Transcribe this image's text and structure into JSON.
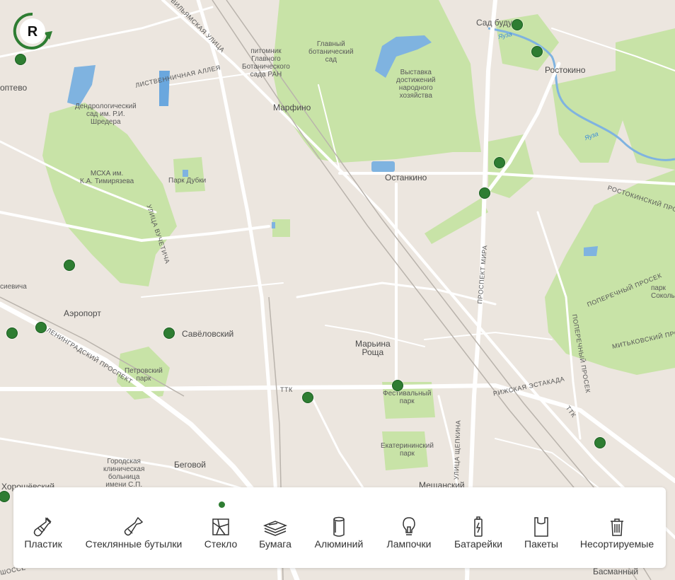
{
  "map": {
    "place_labels": {
      "sad_budushchego": "Сад будущ",
      "rostokino": "Ростокино",
      "glavny_bot_sad": "Главный\nботанический\nсад",
      "pitomnik": "питомник\nГлавного\nБотанического\nсада РАН",
      "vystavka": "Выставка\nдостижений\nнародного\nхозяйства",
      "marfino": "Марфино",
      "ostankino": "Останкино",
      "dendrolog": "Дендрологический\nсад им. Р.И.\nШредера",
      "mskha": "МСХА им.\nК.А. Тимирязева",
      "park_dubki": "Парк Дубки",
      "aeroport": "Аэропорт",
      "savelovsky": "Савёловский",
      "maryina_roshcha": "Марьина\nРоща",
      "festivalny_park": "Фестивальный\nпарк",
      "petrovsky_park": "Петровский\nпарк",
      "ekaterininsky_park": "Екатерининский\nпарк",
      "gorodskaya_bolnitsa": "Городская\nклиническая\nбольница\nимени С.П.",
      "begovoy": "Беговой",
      "meshchansky": "Мещанский",
      "park_sokolniki": "парк\nСокольни",
      "basmanny": "Басманный",
      "khoroshevsky": "Хорошёвский",
      "koptevo": "оптево",
      "timiryazevich": "сиевича"
    },
    "street_labels": {
      "vilamskaya": "ВИЛЬЯМСКАЯ УЛИЦА",
      "listvennichnaya": "ЛИСТВЕННИЧНАЯ АЛЛЕЯ",
      "vuchetich": "УЛИЦА ВУЧЕТИЧА",
      "leningradsky": "ЛЕНИНГРАДСКИЙ ПРОСПЕКТ",
      "prospekt_mira": "ПРОСПЕКТ МИРА",
      "rostokinsky": "РОСТОКИНСКИЙ ПРОЕЗД",
      "poperechny": "ПОПЕРЕЧНЫЙ ПРОСЕК",
      "mitkovsky": "МИТЬКОВСКИЙ ПРОЕЗД",
      "poperechny_v": "ПОПЕРЕЧНЫЙ ПРОСЕК",
      "rizhskaya": "РИЖСКАЯ ЭСТАКАДА",
      "shchepkina": "УЛИЦА ЩЕПКИНА",
      "ttk1": "ТТК",
      "ttk2": "ТТК",
      "shosse": "ШОССЕ"
    },
    "water_labels": {
      "yauza1": "Яуза",
      "yauza2": "Яуза"
    }
  },
  "logo": {
    "letter": "R",
    "color": "#2e7d32"
  },
  "categories": [
    {
      "label": "Пластик",
      "icon": "plastic-bottle-icon"
    },
    {
      "label": "Стеклянные бутылки",
      "icon": "glass-bottle-icon"
    },
    {
      "label": "Стекло",
      "icon": "broken-glass-icon",
      "selected": true
    },
    {
      "label": "Бумага",
      "icon": "paper-stack-icon"
    },
    {
      "label": "Алюминий",
      "icon": "aluminum-can-icon"
    },
    {
      "label": "Лампочки",
      "icon": "lightbulb-icon"
    },
    {
      "label": "Батарейки",
      "icon": "battery-icon"
    },
    {
      "label": "Пакеты",
      "icon": "plastic-bag-icon"
    },
    {
      "label": "Несортируемые",
      "icon": "trash-can-icon"
    }
  ],
  "colors": {
    "marker": "#2e7d32",
    "park": "#c8e3a7",
    "water": "#7fb3e0",
    "background": "#ece6df",
    "road": "#ffffff"
  }
}
